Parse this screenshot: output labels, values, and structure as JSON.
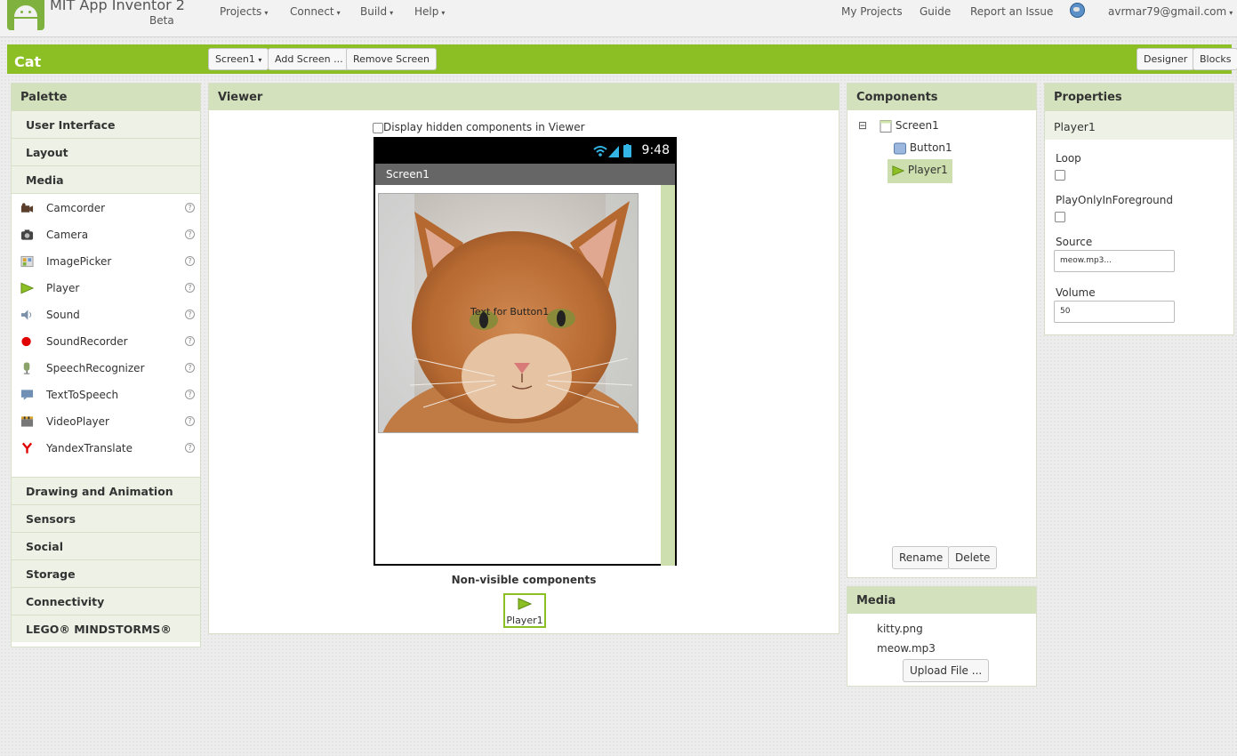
{
  "nav": {
    "app_title": "MIT App Inventor 2",
    "beta": "Beta",
    "menus": [
      "Projects",
      "Connect",
      "Build",
      "Help"
    ],
    "links": [
      "My Projects",
      "Guide",
      "Report an Issue"
    ],
    "account": "avrmar79@gmail.com"
  },
  "toolbar": {
    "project_name": "Cat",
    "screen_select": "Screen1",
    "add_screen": "Add Screen ...",
    "remove_screen": "Remove Screen",
    "designer": "Designer",
    "blocks": "Blocks"
  },
  "palette": {
    "title": "Palette",
    "categories_top": [
      "User Interface",
      "Layout",
      "Media"
    ],
    "media_items": [
      {
        "label": "Camcorder",
        "icon": "camcorder-icon"
      },
      {
        "label": "Camera",
        "icon": "camera-icon"
      },
      {
        "label": "ImagePicker",
        "icon": "image-picker-icon"
      },
      {
        "label": "Player",
        "icon": "player-icon"
      },
      {
        "label": "Sound",
        "icon": "sound-icon"
      },
      {
        "label": "SoundRecorder",
        "icon": "sound-recorder-icon"
      },
      {
        "label": "SpeechRecognizer",
        "icon": "speech-recognizer-icon"
      },
      {
        "label": "TextToSpeech",
        "icon": "text-to-speech-icon"
      },
      {
        "label": "VideoPlayer",
        "icon": "video-player-icon"
      },
      {
        "label": "YandexTranslate",
        "icon": "yandex-translate-icon"
      }
    ],
    "help_glyph": "?",
    "categories_bottom": [
      "Drawing and Animation",
      "Sensors",
      "Social",
      "Storage",
      "Connectivity",
      "LEGO® MINDSTORMS®"
    ]
  },
  "viewer": {
    "title": "Viewer",
    "hidden_label": "Display hidden components in Viewer",
    "hidden_checked": false,
    "phone_time": "9:48",
    "screen_title": "Screen1",
    "button_text": "Text for Button1",
    "nonvisible_title": "Non-visible components",
    "nonvisible_item": "Player1"
  },
  "components": {
    "title": "Components",
    "collapse_glyph": "⊟",
    "screen": "Screen1",
    "children": [
      "Button1",
      "Player1"
    ],
    "selected": "Player1",
    "rename": "Rename",
    "delete": "Delete"
  },
  "media": {
    "title": "Media",
    "files": [
      "kitty.png",
      "meow.mp3"
    ],
    "upload": "Upload File ..."
  },
  "properties": {
    "title": "Properties",
    "component": "Player1",
    "loop_label": "Loop",
    "loop_checked": false,
    "foreground_label": "PlayOnlyInForeground",
    "foreground_checked": false,
    "source_label": "Source",
    "source_value": "meow.mp3...",
    "volume_label": "Volume",
    "volume_value": "50"
  },
  "colors": {
    "accent_green": "#8cbf23",
    "panel_header": "#d3e2bd",
    "selection": "#cddfae"
  }
}
